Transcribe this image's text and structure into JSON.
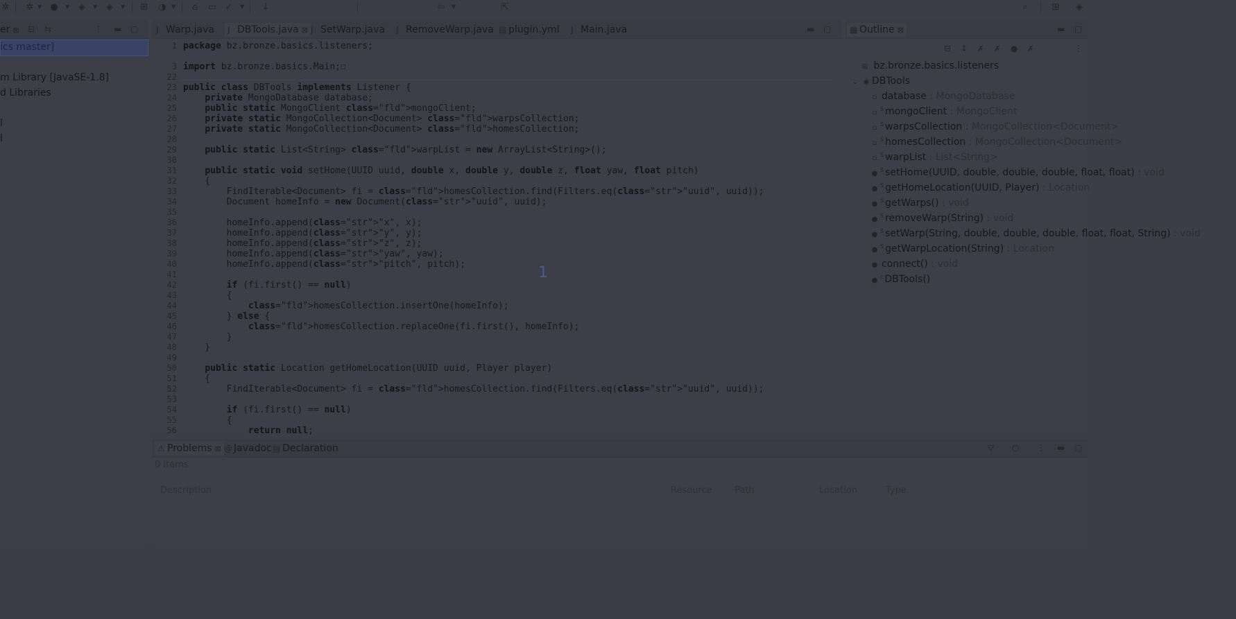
{
  "toolbar": {
    "icons": [
      "debug-icon",
      "run-icon",
      "coverage-icon",
      "external-tools-icon",
      "new-java-project-icon",
      "new-package-icon",
      "open-type-icon",
      "open-task-icon",
      "search-icon",
      "next-annotation-icon",
      "back-icon",
      "forward-icon",
      "pin-editor-icon",
      "quick-access-search-icon",
      "perspective-icon",
      "java-perspective-icon"
    ]
  },
  "explorer": {
    "tab_label": "er",
    "items": [
      {
        "label": "ics master]"
      },
      {
        "label": "m Library [JavaSE-1.8]"
      },
      {
        "label": "d Libraries"
      },
      {
        "label": "l"
      },
      {
        "label": "l"
      }
    ]
  },
  "editor": {
    "tabs": [
      {
        "label": "Warp.java"
      },
      {
        "label": "DBTools.java"
      },
      {
        "label": "SetWarp.java"
      },
      {
        "label": "RemoveWarp.java"
      },
      {
        "label": "plugin.yml"
      },
      {
        "label": "Main.java"
      }
    ],
    "overlay_number": "1",
    "lines": [
      {
        "n": "1",
        "html": "package bz.bronze.basics.listeners;"
      },
      {
        "n": "",
        "html": ""
      },
      {
        "n": "3",
        "html": "import bz.bronze.basics.Main;☐"
      },
      {
        "n": "22",
        "html": ""
      },
      {
        "n": "23",
        "html": "public class DBTools implements Listener {"
      },
      {
        "n": "24",
        "html": "    private MongoDatabase database;"
      },
      {
        "n": "25",
        "html": "    public static MongoClient mongoClient;"
      },
      {
        "n": "26",
        "html": "    private static MongoCollection<Document> warpsCollection;"
      },
      {
        "n": "27",
        "html": "    private static MongoCollection<Document> homesCollection;"
      },
      {
        "n": "28",
        "html": ""
      },
      {
        "n": "29",
        "html": "    public static List<String> warpList = new ArrayList<String>();"
      },
      {
        "n": "30",
        "html": ""
      },
      {
        "n": "31",
        "html": "    public static void setHome(UUID uuid, double x, double y, double z, float yaw, float pitch)"
      },
      {
        "n": "32",
        "html": "    {"
      },
      {
        "n": "33",
        "html": "        FindIterable<Document> fi = homesCollection.find(Filters.eq(\"uuid\", uuid));"
      },
      {
        "n": "34",
        "html": "        Document homeInfo = new Document(\"uuid\", uuid);"
      },
      {
        "n": "35",
        "html": ""
      },
      {
        "n": "36",
        "html": "        homeInfo.append(\"x\", x);"
      },
      {
        "n": "37",
        "html": "        homeInfo.append(\"y\", y);"
      },
      {
        "n": "38",
        "html": "        homeInfo.append(\"z\", z);"
      },
      {
        "n": "39",
        "html": "        homeInfo.append(\"yaw\", yaw);"
      },
      {
        "n": "40",
        "html": "        homeInfo.append(\"pitch\", pitch);"
      },
      {
        "n": "41",
        "html": ""
      },
      {
        "n": "42",
        "html": "        if (fi.first() == null)"
      },
      {
        "n": "43",
        "html": "        {"
      },
      {
        "n": "44",
        "html": "            homesCollection.insertOne(homeInfo);"
      },
      {
        "n": "45",
        "html": "        } else {"
      },
      {
        "n": "46",
        "html": "            homesCollection.replaceOne(fi.first(), homeInfo);"
      },
      {
        "n": "47",
        "html": "        }"
      },
      {
        "n": "48",
        "html": "    }"
      },
      {
        "n": "49",
        "html": ""
      },
      {
        "n": "50",
        "html": "    public static Location getHomeLocation(UUID uuid, Player player)"
      },
      {
        "n": "51",
        "html": "    {"
      },
      {
        "n": "52",
        "html": "        FindIterable<Document> fi = homesCollection.find(Filters.eq(\"uuid\", uuid));"
      },
      {
        "n": "53",
        "html": ""
      },
      {
        "n": "54",
        "html": "        if (fi.first() == null)"
      },
      {
        "n": "55",
        "html": "        {"
      },
      {
        "n": "56",
        "html": "            return null;"
      }
    ]
  },
  "outline": {
    "tab_label": "Outline",
    "package": "bz.bronze.basics.listeners",
    "class_name": "DBTools",
    "members": [
      {
        "label": "database",
        "type": " : MongoDatabase",
        "sup": ""
      },
      {
        "label": "mongoClient",
        "type": " : MongoClient",
        "sup": "S"
      },
      {
        "label": "warpsCollection",
        "type": " : MongoCollection<Document>",
        "sup": "S"
      },
      {
        "label": "homesCollection",
        "type": " : MongoCollection<Document>",
        "sup": "S"
      },
      {
        "label": "warpList",
        "type": " : List<String>",
        "sup": "S"
      },
      {
        "label": "setHome(UUID, double, double, double, float, float)",
        "type": " : void",
        "sup": "S"
      },
      {
        "label": "getHomeLocation(UUID, Player)",
        "type": " : Location",
        "sup": "S"
      },
      {
        "label": "getWarps()",
        "type": " : void",
        "sup": "S"
      },
      {
        "label": "removeWarp(String)",
        "type": " : void",
        "sup": "S"
      },
      {
        "label": "setWarp(String, double, double, double, float, float, String)",
        "type": " : void",
        "sup": "S"
      },
      {
        "label": "getWarpLocation(String)",
        "type": " : Location",
        "sup": "S"
      },
      {
        "label": "connect()",
        "type": " : void",
        "sup": ""
      },
      {
        "label": "DBTools()",
        "type": "",
        "sup": "c"
      }
    ]
  },
  "bottom": {
    "tabs": [
      {
        "label": "Problems"
      },
      {
        "label": "Javadoc"
      },
      {
        "label": "Declaration"
      }
    ],
    "items_count": "0 items",
    "columns": [
      "Description",
      "Resource",
      "Path",
      "Location",
      "Type"
    ]
  },
  "colors": {
    "background": "#3b3e47",
    "overlay_number": "#4a5a8a"
  }
}
